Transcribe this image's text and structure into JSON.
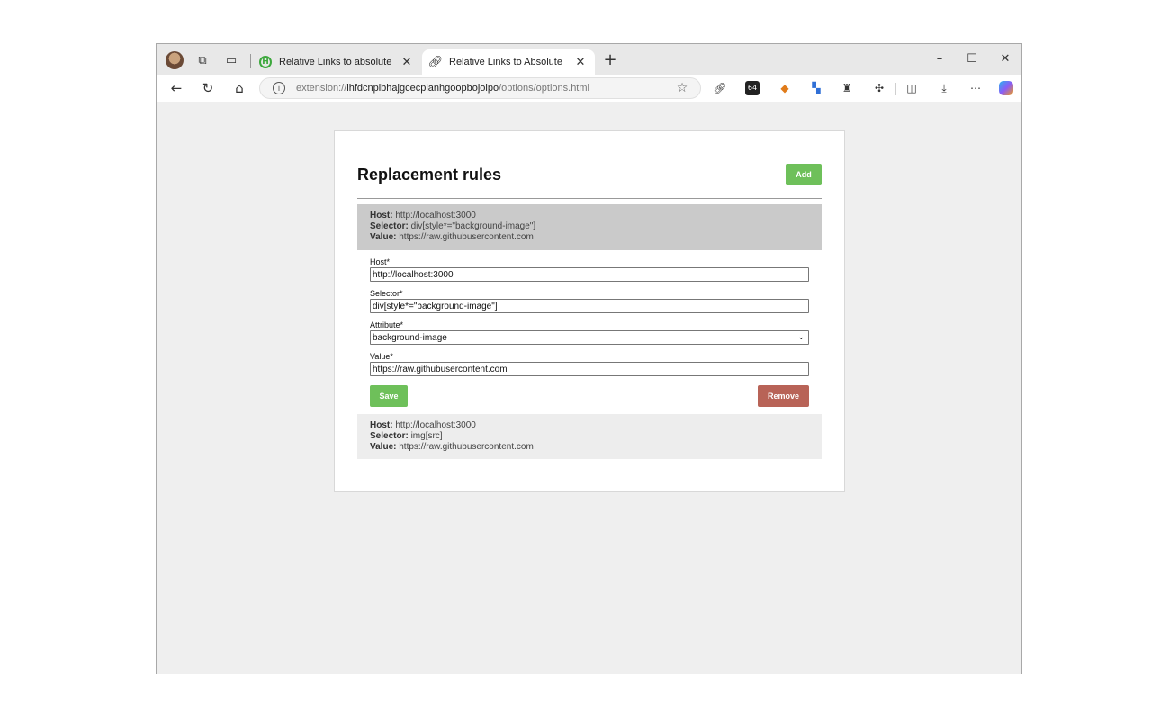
{
  "browser": {
    "tabs": [
      {
        "title": "Relative Links to absolute",
        "active": false
      },
      {
        "title": "Relative Links to Absolute",
        "active": true
      }
    ],
    "address": {
      "prefix": "extension://",
      "host": "lhfdcnpibhajgcecplanhgoopbojoipo",
      "path": "/options/options.html"
    }
  },
  "page": {
    "title": "Replacement rules",
    "add_label": "Add",
    "labels": {
      "host": "Host:",
      "selector": "Selector:",
      "value": "Value:"
    },
    "rules": [
      {
        "host": "http://localhost:3000",
        "selector": "div[style*=\"background-image\"]",
        "value": "https://raw.githubusercontent.com"
      },
      {
        "host": "http://localhost:3000",
        "selector": "img[src]",
        "value": "https://raw.githubusercontent.com"
      }
    ],
    "form": {
      "host_label": "Host*",
      "host_value": "http://localhost:3000",
      "selector_label": "Selector*",
      "selector_value": "div[style*=\"background-image\"]",
      "attribute_label": "Attribute*",
      "attribute_value": "background-image",
      "value_label": "Value*",
      "value_value": "https://raw.githubusercontent.com",
      "save_label": "Save",
      "remove_label": "Remove"
    }
  },
  "colors": {
    "add_button": "#6ec05a",
    "save_button": "#6ec05a",
    "remove_button": "#b86357",
    "selected_rule_bg": "#cacaca",
    "other_rule_bg": "#ededed"
  }
}
